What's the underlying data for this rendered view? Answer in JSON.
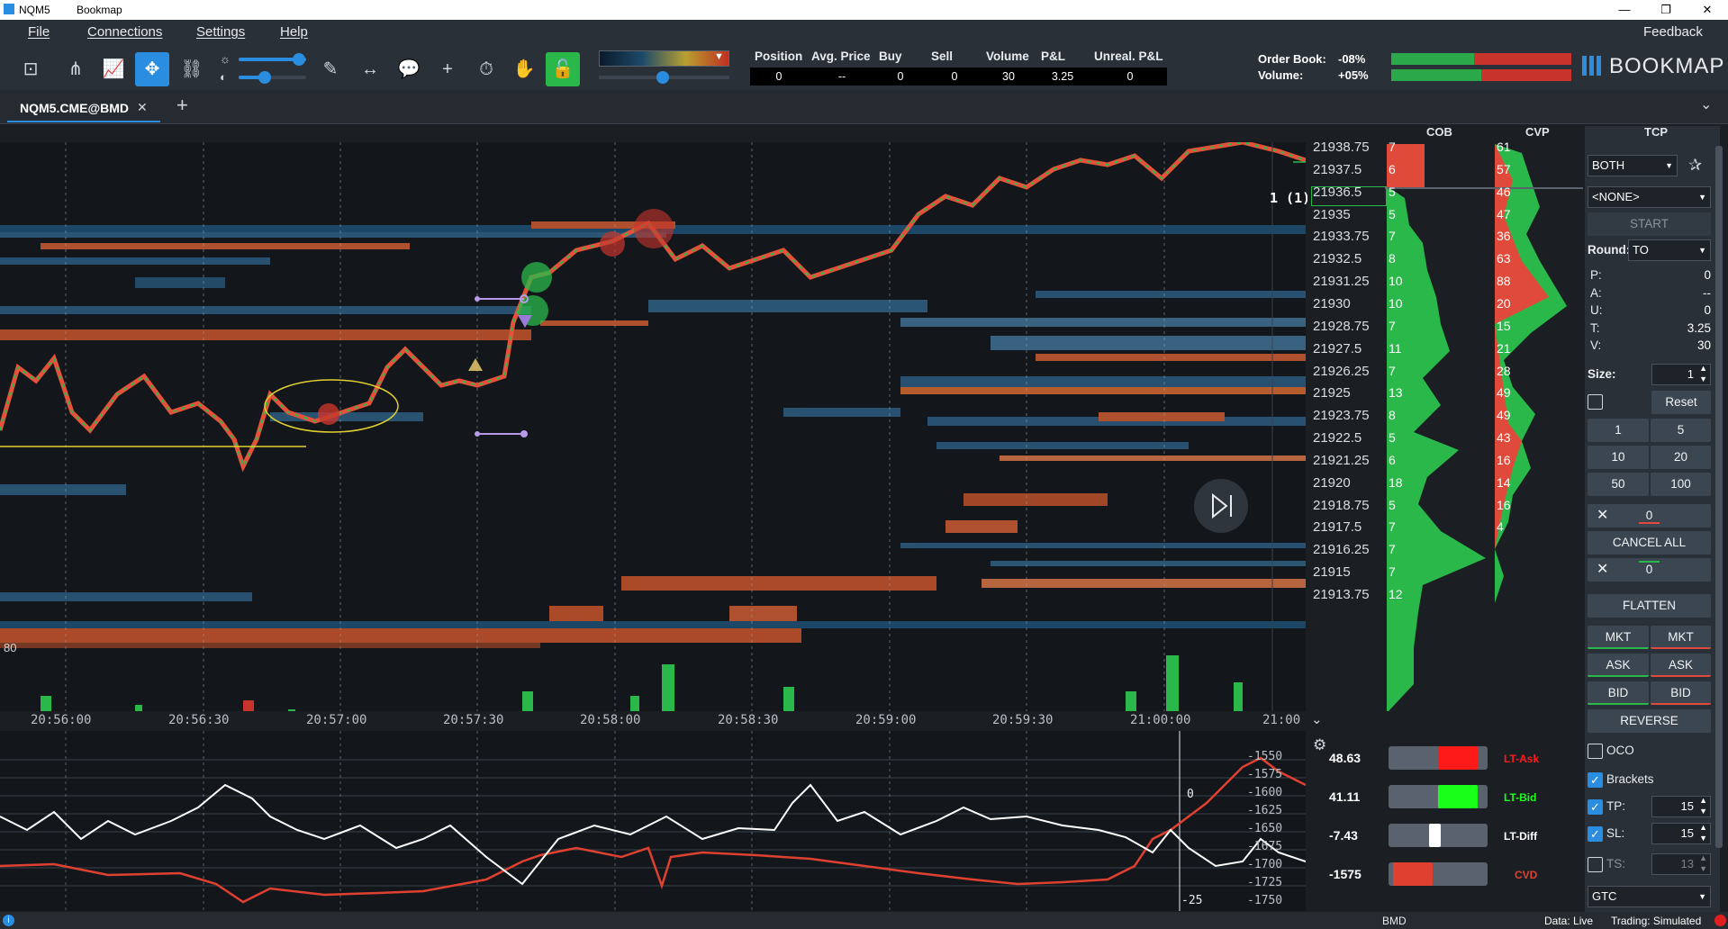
{
  "titlebar": {
    "app_code": "NQM5",
    "title": "Bookmap"
  },
  "menu": {
    "file": "File",
    "connections": "Connections",
    "settings": "Settings",
    "help": "Help",
    "feedback": "Feedback"
  },
  "stats": {
    "headers": [
      "Position",
      "Avg. Price",
      "Buy",
      "Sell",
      "Volume",
      "P&L",
      "Unreal. P&L"
    ],
    "values": [
      "0",
      "--",
      "0",
      "0",
      "30",
      "3.25",
      "0"
    ]
  },
  "orderbook": {
    "label": "Order Book:",
    "value": "-08%",
    "volume_label": "Volume:",
    "volume_value": "+05%"
  },
  "brand": {
    "name": "BOOKMAP",
    "accent": "#2b8de0"
  },
  "tab": {
    "label": "NQM5.CME@BMD",
    "add": "+"
  },
  "columns": {
    "cob": "COB",
    "cvp": "CVP",
    "tcp": "TCP"
  },
  "price_ladder": [
    {
      "price": "21938.75",
      "cob": "7",
      "cvp": "61"
    },
    {
      "price": "21937.5",
      "cob": "6",
      "cvp": "57"
    },
    {
      "price": "21936.5",
      "cob": "5",
      "cvp": "46"
    },
    {
      "price": "21935",
      "cob": "5",
      "cvp": "47"
    },
    {
      "price": "21933.75",
      "cob": "7",
      "cvp": "36"
    },
    {
      "price": "21932.5",
      "cob": "8",
      "cvp": "63"
    },
    {
      "price": "21931.25",
      "cob": "10",
      "cvp": "88"
    },
    {
      "price": "21930",
      "cob": "10",
      "cvp": "20"
    },
    {
      "price": "21928.75",
      "cob": "7",
      "cvp": "15"
    },
    {
      "price": "21927.5",
      "cob": "11",
      "cvp": "21"
    },
    {
      "price": "21926.25",
      "cob": "7",
      "cvp": "28"
    },
    {
      "price": "21925",
      "cob": "13",
      "cvp": "49"
    },
    {
      "price": "21923.75",
      "cob": "8",
      "cvp": "49"
    },
    {
      "price": "21922.5",
      "cob": "5",
      "cvp": "43"
    },
    {
      "price": "21921.25",
      "cob": "6",
      "cvp": "16"
    },
    {
      "price": "21920",
      "cob": "18",
      "cvp": "14"
    },
    {
      "price": "21918.75",
      "cob": "5",
      "cvp": "16"
    },
    {
      "price": "21917.5",
      "cob": "7",
      "cvp": "4"
    },
    {
      "price": "21916.25",
      "cob": "7",
      "cvp": ""
    },
    {
      "price": "21915",
      "cob": "7",
      "cvp": ""
    },
    {
      "price": "21913.75",
      "cob": "12",
      "cvp": ""
    }
  ],
  "position_marker": {
    "label": "1 (1)"
  },
  "left_axis_label": "80",
  "time_axis": [
    "20:56:00",
    "20:56:30",
    "20:57:00",
    "20:57:30",
    "20:58:00",
    "20:58:30",
    "20:59:00",
    "20:59:30",
    "21:00:00",
    "21:00"
  ],
  "lower_axis": {
    "right": [
      "-1550",
      "-1575",
      "-1600",
      "-1625",
      "-1650",
      "-1675",
      "-1700",
      "-1725",
      "-1750"
    ],
    "zero": "0",
    "minus25": "-25"
  },
  "indicators": [
    {
      "value": "48.63",
      "label": "LT-Ask",
      "color": "#ff1a1a",
      "fill": 0.5
    },
    {
      "value": "41.11",
      "label": "LT-Bid",
      "color": "#1aff1a",
      "fill": 0.5
    },
    {
      "value": "-7.43",
      "label": "LT-Diff",
      "color": "#ffffff",
      "fill": 0.15
    },
    {
      "value": "-1575",
      "label": "CVD",
      "color": "#e04030",
      "fill": 0.5
    }
  ],
  "tcp": {
    "side": "BOTH",
    "strategy": "<NONE>",
    "start": "START",
    "round_label": "Round:",
    "round_value": "TO",
    "p_label": "P:",
    "p": "0",
    "a_label": "A:",
    "a": "--",
    "u_label": "U:",
    "u": "0",
    "t_label": "T:",
    "t": "3.25",
    "v_label": "V:",
    "v": "30",
    "size_label": "Size:",
    "size": "1",
    "reset": "Reset",
    "qty": [
      "1",
      "5",
      "10",
      "20",
      "50",
      "100"
    ],
    "cancel_top": "0",
    "cancel_all": "CANCEL ALL",
    "cancel_bottom": "0",
    "flatten": "FLATTEN",
    "mkt": "MKT",
    "ask": "ASK",
    "bid": "BID",
    "reverse": "REVERSE",
    "oco": "OCO",
    "brackets": "Brackets",
    "tp_label": "TP:",
    "tp": "15",
    "sl_label": "SL:",
    "sl": "15",
    "ts_label": "TS:",
    "ts": "13",
    "tif": "GTC"
  },
  "status": {
    "provider": "BMD",
    "data": "Data: Live",
    "trading": "Trading: Simulated"
  }
}
